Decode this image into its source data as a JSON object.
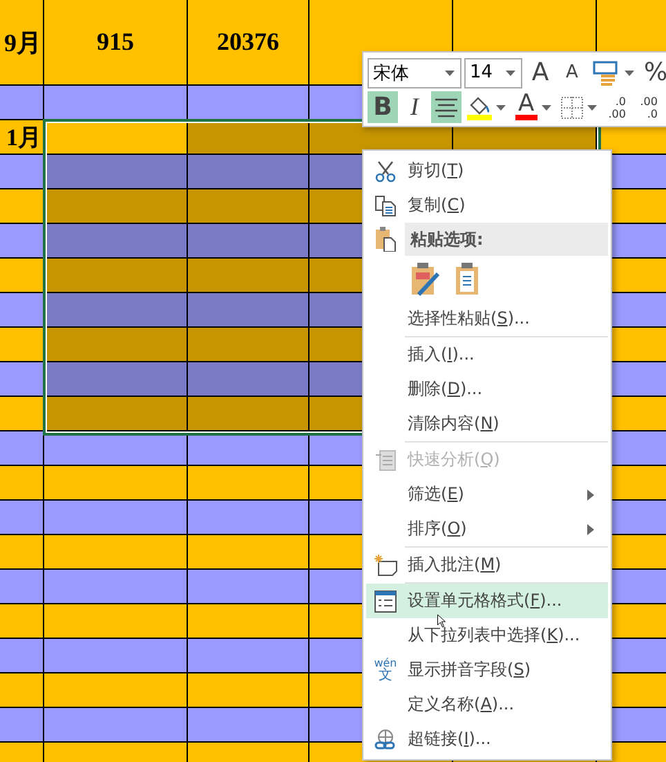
{
  "sheet": {
    "rows": [
      {
        "color": "#ffc000",
        "selected": false,
        "cells": [
          "9月",
          "915",
          "20376"
        ]
      },
      {
        "color": "#9999ff",
        "selected": false
      },
      {
        "color": "#ffc000",
        "selected": true,
        "cells": [
          "1月"
        ]
      },
      {
        "color": "#9999ff",
        "selected": true
      },
      {
        "color": "#ffc000",
        "selected": true
      },
      {
        "color": "#9999ff",
        "selected": true
      },
      {
        "color": "#ffc000",
        "selected": true
      },
      {
        "color": "#9999ff",
        "selected": true
      },
      {
        "color": "#ffc000",
        "selected": true
      },
      {
        "color": "#9999ff",
        "selected": true
      },
      {
        "color": "#ffc000",
        "selected": true
      },
      {
        "color": "#9999ff",
        "selected": false
      },
      {
        "color": "#ffc000",
        "selected": false
      },
      {
        "color": "#9999ff",
        "selected": false
      },
      {
        "color": "#ffc000",
        "selected": false
      },
      {
        "color": "#9999ff",
        "selected": false
      },
      {
        "color": "#ffc000",
        "selected": false
      },
      {
        "color": "#9999ff",
        "selected": false
      },
      {
        "color": "#ffc000",
        "selected": false
      },
      {
        "color": "#9999ff",
        "selected": false
      },
      {
        "color": "#ffc000",
        "selected": false
      }
    ]
  },
  "mini_toolbar": {
    "rows": [
      [
        {
          "kind": "dropdown",
          "value": "宋体"
        },
        {
          "kind": "dropdown",
          "value": "14"
        },
        {
          "kind": "glyph",
          "text": "A",
          "selected": false
        },
        {
          "kind": "glyph",
          "text": "A",
          "selected": false
        },
        {
          "kind": "icon",
          "caret": true,
          "selected": false
        },
        {
          "kind": "glyph",
          "text": "%",
          "selected": false
        }
      ],
      [
        {
          "kind": "glyph",
          "text": "B",
          "selected": true
        },
        {
          "kind": "glyph",
          "text": "I",
          "selected": false
        },
        {
          "kind": "icon",
          "caret": false,
          "selected": true
        },
        {
          "kind": "icon",
          "caret": true,
          "selected": false
        },
        {
          "kind": "color_glyph",
          "text": "A",
          "color": "#ff0000",
          "caret": true
        },
        {
          "kind": "icon",
          "caret": true,
          "selected": false
        },
        {
          "kind": "decimal",
          "top": ".0",
          "bottom": ".00"
        },
        {
          "kind": "decimal",
          "top": ".00",
          "bottom": ".0"
        }
      ]
    ]
  },
  "context_menu": {
    "items": [
      {
        "kind": "item",
        "label": "剪切(",
        "key": "T",
        "after": ")",
        "disabled": false,
        "selected": false,
        "submenu": false
      },
      {
        "kind": "item",
        "label": "复制(",
        "key": "C",
        "after": ")",
        "disabled": false,
        "selected": false,
        "submenu": false
      },
      {
        "kind": "header",
        "label": "粘贴选项:"
      },
      {
        "kind": "paste_icons"
      },
      {
        "kind": "item",
        "label": "选择性粘贴(",
        "key": "S",
        "after": ")...",
        "disabled": false,
        "selected": false,
        "submenu": false
      },
      {
        "kind": "separator"
      },
      {
        "kind": "item",
        "label": "插入(",
        "key": "I",
        "after": ")...",
        "disabled": false,
        "selected": false,
        "submenu": false
      },
      {
        "kind": "item",
        "label": "删除(",
        "key": "D",
        "after": ")...",
        "disabled": false,
        "selected": false,
        "submenu": false
      },
      {
        "kind": "item",
        "label": "清除内容(",
        "key": "N",
        "after": ")",
        "disabled": false,
        "selected": false,
        "submenu": false
      },
      {
        "kind": "separator"
      },
      {
        "kind": "item",
        "label": "快速分析(",
        "key": "Q",
        "after": ")",
        "disabled": true,
        "selected": false,
        "submenu": false
      },
      {
        "kind": "item",
        "label": "筛选(",
        "key": "E",
        "after": ")",
        "disabled": false,
        "selected": false,
        "submenu": true
      },
      {
        "kind": "item",
        "label": "排序(",
        "key": "O",
        "after": ")",
        "disabled": false,
        "selected": false,
        "submenu": true
      },
      {
        "kind": "separator"
      },
      {
        "kind": "item",
        "label": "插入批注(",
        "key": "M",
        "after": ")",
        "disabled": false,
        "selected": false,
        "submenu": false
      },
      {
        "kind": "separator"
      },
      {
        "kind": "item",
        "label": "设置单元格格式(",
        "key": "F",
        "after": ")...",
        "disabled": false,
        "selected": true,
        "submenu": false
      },
      {
        "kind": "item",
        "label": "从下拉列表中选择(",
        "key": "K",
        "after": ")...",
        "disabled": false,
        "selected": false,
        "submenu": false
      },
      {
        "kind": "item",
        "icon_text": "wén",
        "icon_glyph": "文",
        "label": "显示拼音字段(",
        "key": "S",
        "after": ")",
        "disabled": false,
        "selected": false,
        "submenu": false
      },
      {
        "kind": "item",
        "label": "定义名称(",
        "key": "A",
        "after": ")...",
        "disabled": false,
        "selected": false,
        "submenu": false
      },
      {
        "kind": "item",
        "label": "超链接(",
        "key": "I",
        "after": ")...",
        "disabled": false,
        "selected": false,
        "submenu": false
      }
    ]
  }
}
